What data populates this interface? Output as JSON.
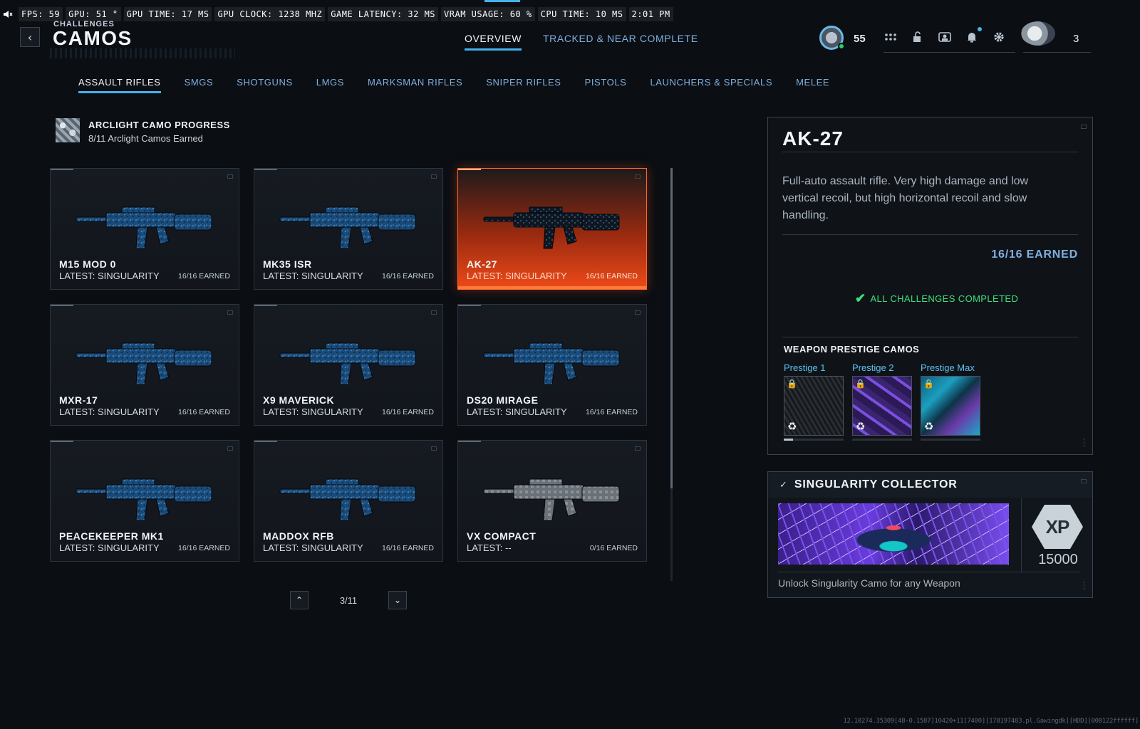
{
  "perf": {
    "items": [
      "FPS:  59",
      "GPU: 51 °",
      "GPU TIME: 17 MS",
      "GPU CLOCK: 1238 MHZ",
      "GAME LATENCY: 32 MS",
      "VRAM USAGE: 60 %",
      "CPU TIME: 10 MS",
      "2:01 PM"
    ]
  },
  "header": {
    "breadcrumb": "CHALLENGES",
    "title": "CAMOS",
    "tabs": [
      "OVERVIEW",
      "TRACKED & NEAR COMPLETE"
    ],
    "active_tab": 0
  },
  "hud": {
    "level": "55",
    "icons": [
      "grid-icon",
      "lock-icon",
      "id-card-icon",
      "bell-icon",
      "gear-icon"
    ],
    "emblem_count": "3"
  },
  "categories": {
    "items": [
      "ASSAULT RIFLES",
      "SMGS",
      "SHOTGUNS",
      "LMGS",
      "MARKSMAN RIFLES",
      "SNIPER RIFLES",
      "PISTOLS",
      "LAUNCHERS & SPECIALS",
      "MELEE"
    ],
    "active": 0
  },
  "arclight": {
    "title": "ARCLIGHT CAMO PROGRESS",
    "subtitle": "8/11 Arclight Camos Earned"
  },
  "weapons": [
    {
      "name": "M15 MOD 0",
      "latest": "LATEST: SINGULARITY",
      "earned": "16/16 EARNED",
      "camo": "blue"
    },
    {
      "name": "MK35 ISR",
      "latest": "LATEST: SINGULARITY",
      "earned": "16/16 EARNED",
      "camo": "blue"
    },
    {
      "name": "AK-27",
      "latest": "LATEST: SINGULARITY",
      "earned": "16/16 EARNED",
      "camo": "dark"
    },
    {
      "name": "MXR-17",
      "latest": "LATEST: SINGULARITY",
      "earned": "16/16 EARNED",
      "camo": "blue"
    },
    {
      "name": "X9 MAVERICK",
      "latest": "LATEST: SINGULARITY",
      "earned": "16/16 EARNED",
      "camo": "blue"
    },
    {
      "name": "DS20 MIRAGE",
      "latest": "LATEST: SINGULARITY",
      "earned": "16/16 EARNED",
      "camo": "blue"
    },
    {
      "name": "PEACEKEEPER MK1",
      "latest": "LATEST: SINGULARITY",
      "earned": "16/16 EARNED",
      "camo": "blue"
    },
    {
      "name": "MADDOX RFB",
      "latest": "LATEST: SINGULARITY",
      "earned": "16/16 EARNED",
      "camo": "blue"
    },
    {
      "name": "VX COMPACT",
      "latest": "LATEST: --",
      "earned": "0/16 EARNED",
      "camo": "grey"
    }
  ],
  "selected_index": 2,
  "pager": {
    "text": "3/11"
  },
  "detail": {
    "title": "AK-27",
    "description": "Full-auto assault rifle. Very high damage and low vertical recoil, but high horizontal recoil and slow handling.",
    "earned": "16/16 EARNED",
    "status": "ALL CHALLENGES COMPLETED",
    "prestige_header": "WEAPON PRESTIGE CAMOS",
    "prestige": [
      {
        "label": "Prestige 1",
        "progress": 0.15
      },
      {
        "label": "Prestige 2",
        "progress": 0
      },
      {
        "label": "Prestige Max",
        "progress": 0
      }
    ]
  },
  "collector": {
    "title": "SINGULARITY COLLECTOR",
    "xp_label": "XP",
    "xp_value": "15000",
    "description": "Unlock Singularity Camo for any Weapon"
  },
  "build_id": "12.10274.35309[48-0.1587]10420+11[7400][178197483.pl.Gawingdk][HDD][000122ffffff]",
  "colors": {
    "accent": "#45b3ea",
    "selected": "#ef4a18",
    "complete": "#3ee07a",
    "link": "#7fb0e0"
  }
}
